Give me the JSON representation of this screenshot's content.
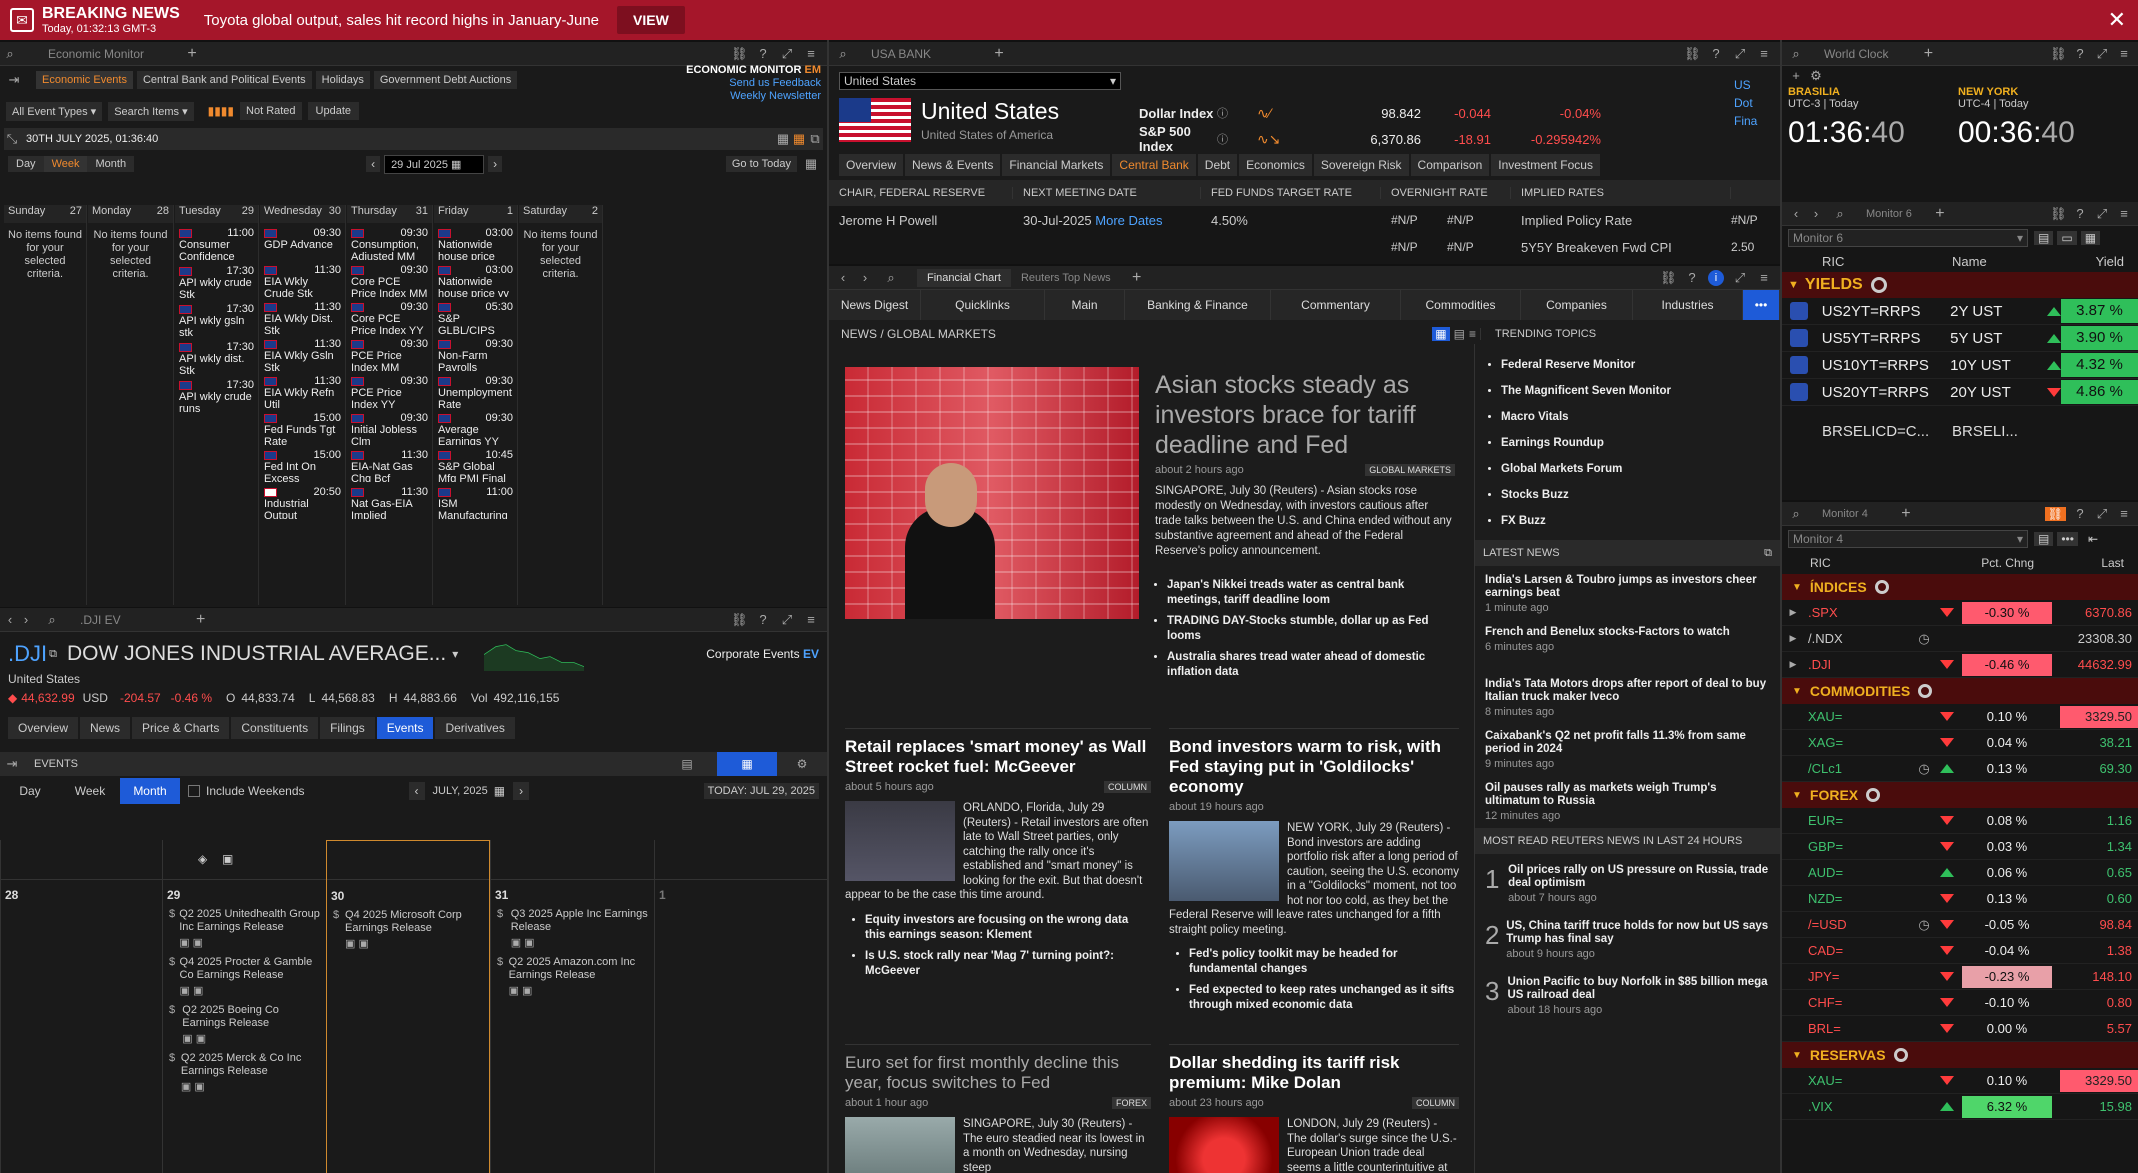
{
  "breaking": {
    "title": "BREAKING NEWS",
    "time": "Today, 01:32:13 GMT-3",
    "headline": "Toyota global output, sales hit record highs in January-June",
    "view": "VIEW"
  },
  "econ": {
    "tab": "Economic Monitor",
    "label_main": "ECONOMIC MONITOR",
    "label_em": "EM",
    "feedback": "Send us Feedback",
    "newsletter": "Weekly Newsletter",
    "subtabs": [
      "Economic Events",
      "Central Bank and Political Events",
      "Holidays",
      "Government Debt Auctions"
    ],
    "filter1": "All Event Types",
    "filter2": "Search Items",
    "not_rated": "Not Rated",
    "update": "Update",
    "date_header": "30TH JULY 2025, 01:36:40",
    "views": [
      "Day",
      "Week",
      "Month"
    ],
    "date_input": "29 Jul 2025",
    "goto": "Go to Today",
    "days": [
      {
        "name": "Sunday",
        "num": "27"
      },
      {
        "name": "Monday",
        "num": "28"
      },
      {
        "name": "Tuesday",
        "num": "29"
      },
      {
        "name": "Wednesday",
        "num": "30"
      },
      {
        "name": "Thursday",
        "num": "31"
      },
      {
        "name": "Friday",
        "num": "1"
      },
      {
        "name": "Saturday",
        "num": "2"
      }
    ],
    "empty": "No items found for your selected criteria.",
    "tue": [
      {
        "t": "11:00",
        "n": "Consumer Confidence"
      },
      {
        "t": "17:30",
        "n": "API wkly crude Stk"
      },
      {
        "t": "17:30",
        "n": "API wkly gsln stk"
      },
      {
        "t": "17:30",
        "n": "API wkly dist. Stk"
      },
      {
        "t": "17:30",
        "n": "API wkly crude runs"
      }
    ],
    "wed": [
      {
        "t": "09:30",
        "n": "GDP Advance"
      },
      {
        "t": "11:30",
        "n": "EIA Wkly Crude Stk"
      },
      {
        "t": "11:30",
        "n": "EIA Wkly Dist. Stk"
      },
      {
        "t": "11:30",
        "n": "EIA Wkly Gsln Stk"
      },
      {
        "t": "11:30",
        "n": "EIA Wkly Refn Util"
      },
      {
        "t": "15:00",
        "n": "Fed Funds Tgt Rate"
      },
      {
        "t": "15:00",
        "n": "Fed Int On Excess Reserves"
      },
      {
        "t": "20:50",
        "n": "Industrial Output"
      }
    ],
    "thu": [
      {
        "t": "09:30",
        "n": "Consumption, Adjusted MM"
      },
      {
        "t": "09:30",
        "n": "Core PCE Price Index MM"
      },
      {
        "t": "09:30",
        "n": "Core PCE Price Index YY"
      },
      {
        "t": "09:30",
        "n": "PCE Price Index MM"
      },
      {
        "t": "09:30",
        "n": "PCE Price Index YY"
      },
      {
        "t": "09:30",
        "n": "Initial Jobless Clm"
      },
      {
        "t": "11:30",
        "n": "EIA-Nat Gas Chg Bcf"
      },
      {
        "t": "11:30",
        "n": "Nat Gas-EIA Implied"
      }
    ],
    "fri": [
      {
        "t": "03:00",
        "n": "Nationwide house price mm"
      },
      {
        "t": "03:00",
        "n": "Nationwide house price yy"
      },
      {
        "t": "05:30",
        "n": "S&P GLBL/CIPS Mfg PMI FNL"
      },
      {
        "t": "09:30",
        "n": "Non-Farm Payrolls"
      },
      {
        "t": "09:30",
        "n": "Unemployment Rate"
      },
      {
        "t": "09:30",
        "n": "Average Earnings YY"
      },
      {
        "t": "10:45",
        "n": "S&P Global Mfg PMI Final"
      },
      {
        "t": "11:00",
        "n": "ISM Manufacturing"
      }
    ]
  },
  "dji": {
    "tab": ".DJI EV",
    "ric": ".DJI",
    "name": "DOW JONES INDUSTRIAL AVERAGE...",
    "country": "United States",
    "corp": "Corporate Events",
    "ev": "EV",
    "last": "44,632.99",
    "ccy": "USD",
    "chg": "-204.57",
    "pct": "-0.46 %",
    "o_lbl": "O",
    "o": "44,833.74",
    "l_lbl": "L",
    "l": "44,568.83",
    "h_lbl": "H",
    "h": "44,883.66",
    "vol_lbl": "Vol",
    "vol": "492,116,155",
    "tabs": [
      "Overview",
      "News",
      "Price & Charts",
      "Constituents",
      "Filings",
      "Events",
      "Derivatives"
    ],
    "events": "EVENTS",
    "views": [
      "Day",
      "Week",
      "Month"
    ],
    "incl": "Include Weekends",
    "month": "JULY, 2025",
    "today": "TODAY: JUL 29, 2025",
    "cols": [
      {
        "d": "28",
        "items": []
      },
      {
        "d": "29",
        "items": [
          "Q2 2025 Unitedhealth Group Inc Earnings Release",
          "Q4 2025 Procter & Gamble Co Earnings Release",
          "Q2 2025 Boeing Co Earnings Release",
          "Q2 2025 Merck & Co Inc Earnings Release"
        ]
      },
      {
        "d": "30",
        "items": [
          "Q4 2025 Microsoft Corp Earnings Release"
        ]
      },
      {
        "d": "31",
        "items": [
          "Q3 2025 Apple Inc Earnings Release",
          "Q2 2025 Amazon.com Inc Earnings Release"
        ]
      },
      {
        "d": "1",
        "items": []
      }
    ]
  },
  "bank": {
    "tab": "USA BANK",
    "sel": "United States",
    "title": "United States",
    "sub": "United States of America",
    "idx": [
      {
        "n": "Dollar Index",
        "v": "98.842",
        "c": "-0.044",
        "p": "-0.04%"
      },
      {
        "n": "S&P 500 Index",
        "v": "6,370.86",
        "c": "-18.91",
        "p": "-0.295942%"
      }
    ],
    "tabs": [
      "Overview",
      "News & Events",
      "Financial Markets",
      "Central Bank",
      "Debt",
      "Economics",
      "Sovereign Risk",
      "Comparison",
      "Investment Focus"
    ],
    "h": [
      "CHAIR, FEDERAL RESERVE",
      "NEXT MEETING DATE",
      "FED FUNDS TARGET RATE",
      "OVERNIGHT RATE",
      "IMPLIED RATES"
    ],
    "chair": "Jerome H Powell",
    "next": "30-Jul-2025",
    "more": "More Dates",
    "rate": "4.50%",
    "na": "#N/P",
    "ir1": "Implied Policy Rate",
    "ir2": "5Y5Y Breakeven Fwd CPI",
    "ir2v": "2.50",
    "side": [
      "US",
      "Dot",
      "Fina"
    ]
  },
  "news": {
    "tab1": "Financial Chart",
    "tab2": "Reuters Top News",
    "nav": [
      "News Digest",
      "Quicklinks",
      "Main",
      "Banking & Finance",
      "Commentary",
      "Commodities",
      "Companies",
      "Industries",
      "•••"
    ],
    "section": "NEWS / GLOBAL MARKETS",
    "lead": {
      "h": "Asian stocks steady as investors brace for tariff deadline and Fed",
      "age": "about 2 hours ago",
      "tag": "GLOBAL MARKETS",
      "body": "SINGAPORE, July 30 (Reuters) - Asian stocks rose modestly on Wednesday, with investors cautious after trade talks between the U.S. and China ended without any substantive agreement and ahead of the Federal Reserve's policy announcement.",
      "bullets": [
        "Japan's Nikkei treads water as central bank meetings, tariff deadline loom",
        "TRADING DAY-Stocks stumble, dollar up as Fed looms",
        "Australia shares tread water ahead of domestic inflation data"
      ]
    },
    "a2": {
      "h": "Retail replaces 'smart money' as Wall Street rocket fuel: McGeever",
      "age": "about 5 hours ago",
      "tag": "COLUMN",
      "body": "ORLANDO, Florida, July 29 (Reuters) - Retail investors are often late to Wall Street parties, only catching the rally once it's established and \"smart money\" is looking for the exit. But that doesn't appear to be the case this time around.",
      "bullets": [
        "Equity investors are focusing on the wrong data this earnings season: Klement",
        "Is U.S. stock rally near 'Mag 7' turning point?: McGeever"
      ]
    },
    "a3": {
      "h": "Bond investors warm to risk, with Fed staying put in 'Goldilocks' economy",
      "age": "about 19 hours ago",
      "body": "NEW YORK, July 29 (Reuters) - Bond investors are adding portfolio risk after a long period of caution, seeing the U.S. economy in a \"Goldilocks\" moment, not too hot nor too cold, as they bet the Federal Reserve will leave rates unchanged for a fifth straight policy meeting.",
      "bullets": [
        "Fed's policy toolkit may be headed for fundamental changes",
        "Fed expected to keep rates unchanged as it sifts through mixed economic data"
      ]
    },
    "a4": {
      "h": "Euro set for first monthly decline this year, focus switches to Fed",
      "age": "about 1 hour ago",
      "tag": "FOREX",
      "body": "SINGAPORE, July 30 (Reuters) - The euro steadied near its lowest in a month on Wednesday, nursing steep"
    },
    "a5": {
      "h": "Dollar shedding its tariff risk premium: Mike Dolan",
      "age": "about 23 hours ago",
      "tag": "COLUMN",
      "body": "LONDON, July 29 (Reuters) - The dollar's surge since the U.S.-European Union trade deal seems a little counterintuitive at"
    },
    "trending_h": "TRENDING TOPICS",
    "trending": [
      "Federal Reserve Monitor",
      "The Magnificent Seven Monitor",
      "Macro Vitals",
      "Earnings Roundup",
      "Global Markets Forum",
      "Stocks Buzz",
      "FX Buzz"
    ],
    "latest_h": "LATEST NEWS",
    "latest": [
      {
        "h": "India's Larsen & Toubro jumps as investors cheer earnings beat",
        "t": "1 minute ago"
      },
      {
        "h": "French and Benelux stocks-Factors to watch",
        "t": "6 minutes ago"
      },
      {
        "h": "India's Tata Motors drops after report of deal to buy Italian truck maker Iveco",
        "t": "8 minutes ago"
      },
      {
        "h": "Caixabank's Q2 net profit falls 11.3% from same period in 2024",
        "t": "9 minutes ago"
      },
      {
        "h": "Oil pauses rally as markets weigh Trump's ultimatum to Russia",
        "t": "12 minutes ago"
      }
    ],
    "most_h": "MOST READ REUTERS NEWS IN LAST 24 HOURS",
    "most": [
      {
        "n": "1",
        "h": "Oil prices rally on US pressure on Russia, trade deal optimism",
        "t": "about 7 hours ago"
      },
      {
        "n": "2",
        "h": "US, China tariff truce holds for now but US says Trump has final say",
        "t": "about 9 hours ago"
      },
      {
        "n": "3",
        "h": "Union Pacific to buy Norfolk in $85 billion mega US railroad deal",
        "t": "about 18 hours ago"
      }
    ]
  },
  "clock": {
    "tab": "World Clock",
    "c1": {
      "city": "BRASILIA",
      "tz": "UTC-3 | Today",
      "time": "01:36:",
      "sec": "40"
    },
    "c2": {
      "city": "NEW YORK",
      "tz": "UTC-4 | Today",
      "time": "00:36:",
      "sec": "40"
    }
  },
  "m6": {
    "tab": "Monitor 6",
    "sel": "Monitor 6",
    "h": [
      "RIC",
      "Name",
      "Yield"
    ],
    "group": "YIELDS",
    "rows": [
      {
        "ric": "US2YT=RRPS",
        "name": "2Y UST",
        "dir": "up",
        "v": "3.87 %"
      },
      {
        "ric": "US5YT=RRPS",
        "name": "5Y UST",
        "dir": "up",
        "v": "3.90 %"
      },
      {
        "ric": "US10YT=RRPS",
        "name": "10Y UST",
        "dir": "up",
        "v": "4.32 %"
      },
      {
        "ric": "US20YT=RRPS",
        "name": "20Y UST",
        "dir": "dn",
        "v": "4.86 %"
      }
    ],
    "extra": {
      "ric": "BRSELICD=C...",
      "name": "BRSELI..."
    }
  },
  "m4": {
    "tab": "Monitor 4",
    "sel": "Monitor 4",
    "h": [
      "RIC",
      "Pct. Chng",
      "Last"
    ],
    "groups": [
      {
        "name": "ÍNDICES",
        "rows": [
          {
            "ric": ".SPX",
            "dir": "dn",
            "pct": "-0.30 %",
            "last": "6370.86",
            "pbg": "#ff5a6e",
            "lbg": "",
            "lc": "#ff4d4d"
          },
          {
            "ric": "/.NDX",
            "dir": "",
            "pct": "",
            "last": "23308.30",
            "pbg": "",
            "lbg": "",
            "lc": "#ccc",
            "clk": true
          },
          {
            "ric": ".DJI",
            "dir": "dn",
            "pct": "-0.46 %",
            "last": "44632.99",
            "pbg": "#ff5a6e",
            "lbg": "",
            "lc": "#ff4d4d"
          }
        ]
      },
      {
        "name": "COMMODITIES",
        "rows": [
          {
            "ric": "XAU=",
            "dir": "dn",
            "pct": "0.10 %",
            "last": "3329.50",
            "pbg": "",
            "lbg": "#ff5a6e",
            "lc": "#222"
          },
          {
            "ric": "XAG=",
            "dir": "dn",
            "pct": "0.04 %",
            "last": "38.21",
            "pbg": "",
            "lbg": "",
            "lc": "#3ec16e"
          },
          {
            "ric": "/CLc1",
            "dir": "up",
            "pct": "0.13 %",
            "last": "69.30",
            "pbg": "",
            "lbg": "",
            "lc": "#3ec16e",
            "clk": true
          }
        ]
      },
      {
        "name": "FOREX",
        "rows": [
          {
            "ric": "EUR=",
            "dir": "dn",
            "pct": "0.08 %",
            "last": "1.16",
            "pbg": "",
            "lbg": "",
            "lc": "#3ec16e"
          },
          {
            "ric": "GBP=",
            "dir": "dn",
            "pct": "0.03 %",
            "last": "1.34",
            "pbg": "",
            "lbg": "",
            "lc": "#3ec16e"
          },
          {
            "ric": "AUD=",
            "dir": "up",
            "pct": "0.06 %",
            "last": "0.65",
            "pbg": "",
            "lbg": "",
            "lc": "#3ec16e"
          },
          {
            "ric": "NZD=",
            "dir": "dn",
            "pct": "0.13 %",
            "last": "0.60",
            "pbg": "",
            "lbg": "",
            "lc": "#3ec16e"
          },
          {
            "ric": "/=USD",
            "dir": "dn",
            "pct": "-0.05 %",
            "last": "98.84",
            "pbg": "",
            "lbg": "",
            "lc": "#ff4d4d",
            "clk": true
          },
          {
            "ric": "CAD=",
            "dir": "dn",
            "pct": "-0.04 %",
            "last": "1.38",
            "pbg": "",
            "lbg": "",
            "lc": "#ff4d4d"
          },
          {
            "ric": "JPY=",
            "dir": "dn",
            "pct": "-0.23 %",
            "last": "148.10",
            "pbg": "#e8a0a8",
            "lbg": "",
            "lc": "#ff4d4d"
          },
          {
            "ric": "CHF=",
            "dir": "dn",
            "pct": "-0.10 %",
            "last": "0.80",
            "pbg": "",
            "lbg": "",
            "lc": "#ff4d4d"
          },
          {
            "ric": "BRL=",
            "dir": "dn",
            "pct": "0.00 %",
            "last": "5.57",
            "pbg": "",
            "lbg": "",
            "lc": "#ff4d4d"
          }
        ]
      },
      {
        "name": "RESERVAS",
        "rows": [
          {
            "ric": "XAU=",
            "dir": "dn",
            "pct": "0.10 %",
            "last": "3329.50",
            "pbg": "",
            "lbg": "#ff5a6e",
            "lc": "#222"
          },
          {
            "ric": ".VIX",
            "dir": "up",
            "pct": "6.32 %",
            "last": "15.98",
            "pbg": "#4fd66a",
            "lbg": "",
            "lc": "#3ec16e"
          }
        ]
      }
    ]
  }
}
